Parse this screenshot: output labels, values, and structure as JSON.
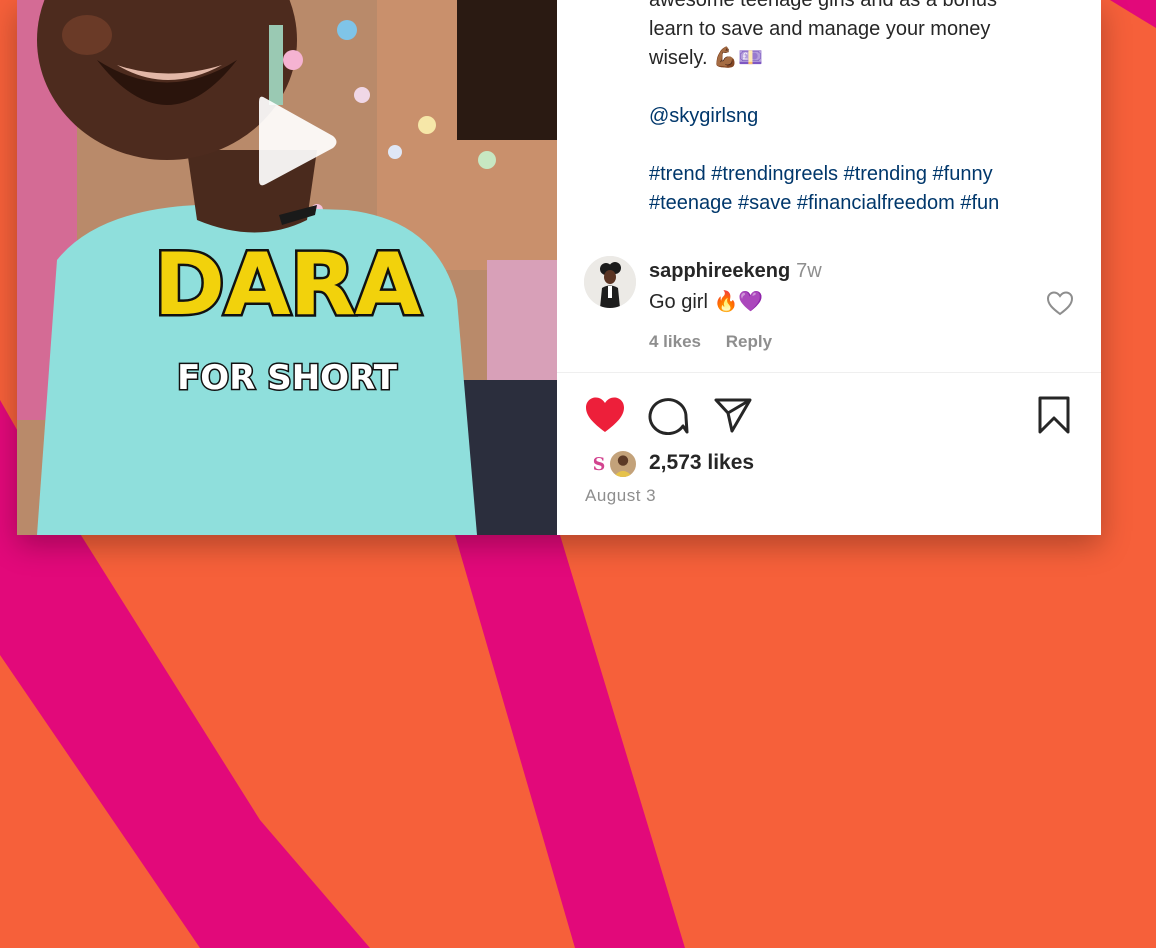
{
  "theme": {
    "background": "#f6603a",
    "stripe": "#e2097a",
    "link": "#00376b",
    "like_red": "#ed1f3a",
    "overlay_yellow": "#f2d20c"
  },
  "video": {
    "overlay_title": "DARA",
    "overlay_subtitle": "FOR SHORT",
    "play_icon": "play-icon"
  },
  "caption": {
    "line1": "awesome teenage girls and as a bonus",
    "line2": "learn to save and manage your money",
    "line3": "wisely. 💪🏾💷",
    "mention": "@skygirlsng",
    "hashtags_line1": "#trend #trendingreels #trending #funny",
    "hashtags_line2": "#teenage #save #financialfreedom #fun"
  },
  "comment": {
    "username": "sapphireekeng",
    "time": "7w",
    "text": "Go girl 🔥💜",
    "likes": "4 likes",
    "reply": "Reply",
    "like_icon": "heart-outline-icon"
  },
  "actions": {
    "icons": [
      "heart-filled-icon",
      "comment-icon",
      "share-icon",
      "bookmark-icon"
    ]
  },
  "post": {
    "likes": "2,573 likes",
    "date": "August 3"
  }
}
